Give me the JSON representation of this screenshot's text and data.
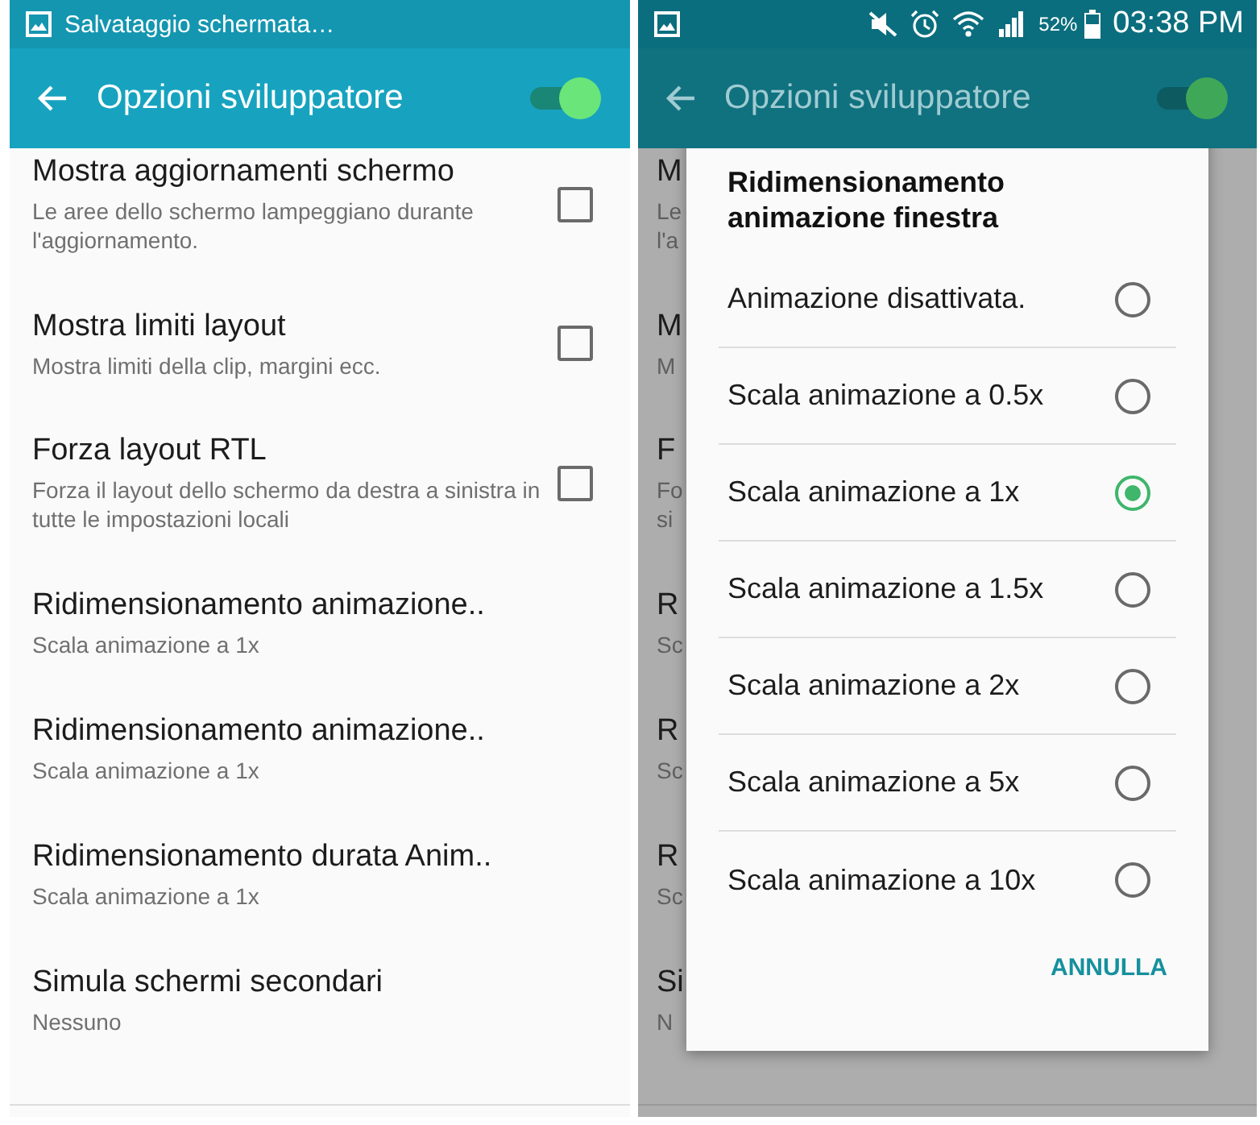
{
  "screens": [
    {
      "status_bar": {
        "notification": "Salvataggio schermata…"
      },
      "header": {
        "title": "Opzioni sviluppatore",
        "switch_on": true
      },
      "items": [
        {
          "title": "Mostra aggiornamenti schermo",
          "subtitle": "Le aree dello schermo lampeggiano durante l'aggiornamento.",
          "kind": "checkbox",
          "checked": false
        },
        {
          "title": "Mostra limiti layout",
          "subtitle": "Mostra limiti della clip, margini ecc.",
          "kind": "checkbox",
          "checked": false
        },
        {
          "title": "Forza layout RTL",
          "subtitle": "Forza il layout dello schermo da destra a sinistra in tutte le impostazioni locali",
          "kind": "checkbox",
          "checked": false
        },
        {
          "title": "Ridimensionamento animazione..",
          "subtitle": "Scala animazione a 1x",
          "kind": "value"
        },
        {
          "title": "Ridimensionamento animazione..",
          "subtitle": "Scala animazione a 1x",
          "kind": "value"
        },
        {
          "title": "Ridimensionamento durata Anim..",
          "subtitle": "Scala animazione a 1x",
          "kind": "value"
        },
        {
          "title": "Simula schermi secondari",
          "subtitle": "Nessuno",
          "kind": "value"
        }
      ]
    },
    {
      "status_bar": {
        "battery": "52%",
        "time": "03:38 PM"
      },
      "header": {
        "title": "Opzioni sviluppatore",
        "switch_on": true
      },
      "items": [
        {
          "title": "M",
          "subtitle": "Le l'a"
        },
        {
          "title": "M",
          "subtitle": "M"
        },
        {
          "title": "F",
          "subtitle": "Fo si"
        },
        {
          "title": "R",
          "subtitle": "Sc"
        },
        {
          "title": "R",
          "subtitle": "Sc"
        },
        {
          "title": "R",
          "subtitle": "Sc"
        },
        {
          "title": "Si",
          "subtitle": "N"
        }
      ],
      "dialog": {
        "title": "Ridimensionamento animazione finestra",
        "options": [
          {
            "label": "Animazione disattivata.",
            "selected": false
          },
          {
            "label": "Scala animazione a 0.5x",
            "selected": false
          },
          {
            "label": "Scala animazione a 1x",
            "selected": true
          },
          {
            "label": "Scala animazione a 1.5x",
            "selected": false
          },
          {
            "label": "Scala animazione a 2x",
            "selected": false
          },
          {
            "label": "Scala animazione a 5x",
            "selected": false
          },
          {
            "label": "Scala animazione a 10x",
            "selected": false
          }
        ],
        "cancel": "ANNULLA"
      }
    }
  ]
}
